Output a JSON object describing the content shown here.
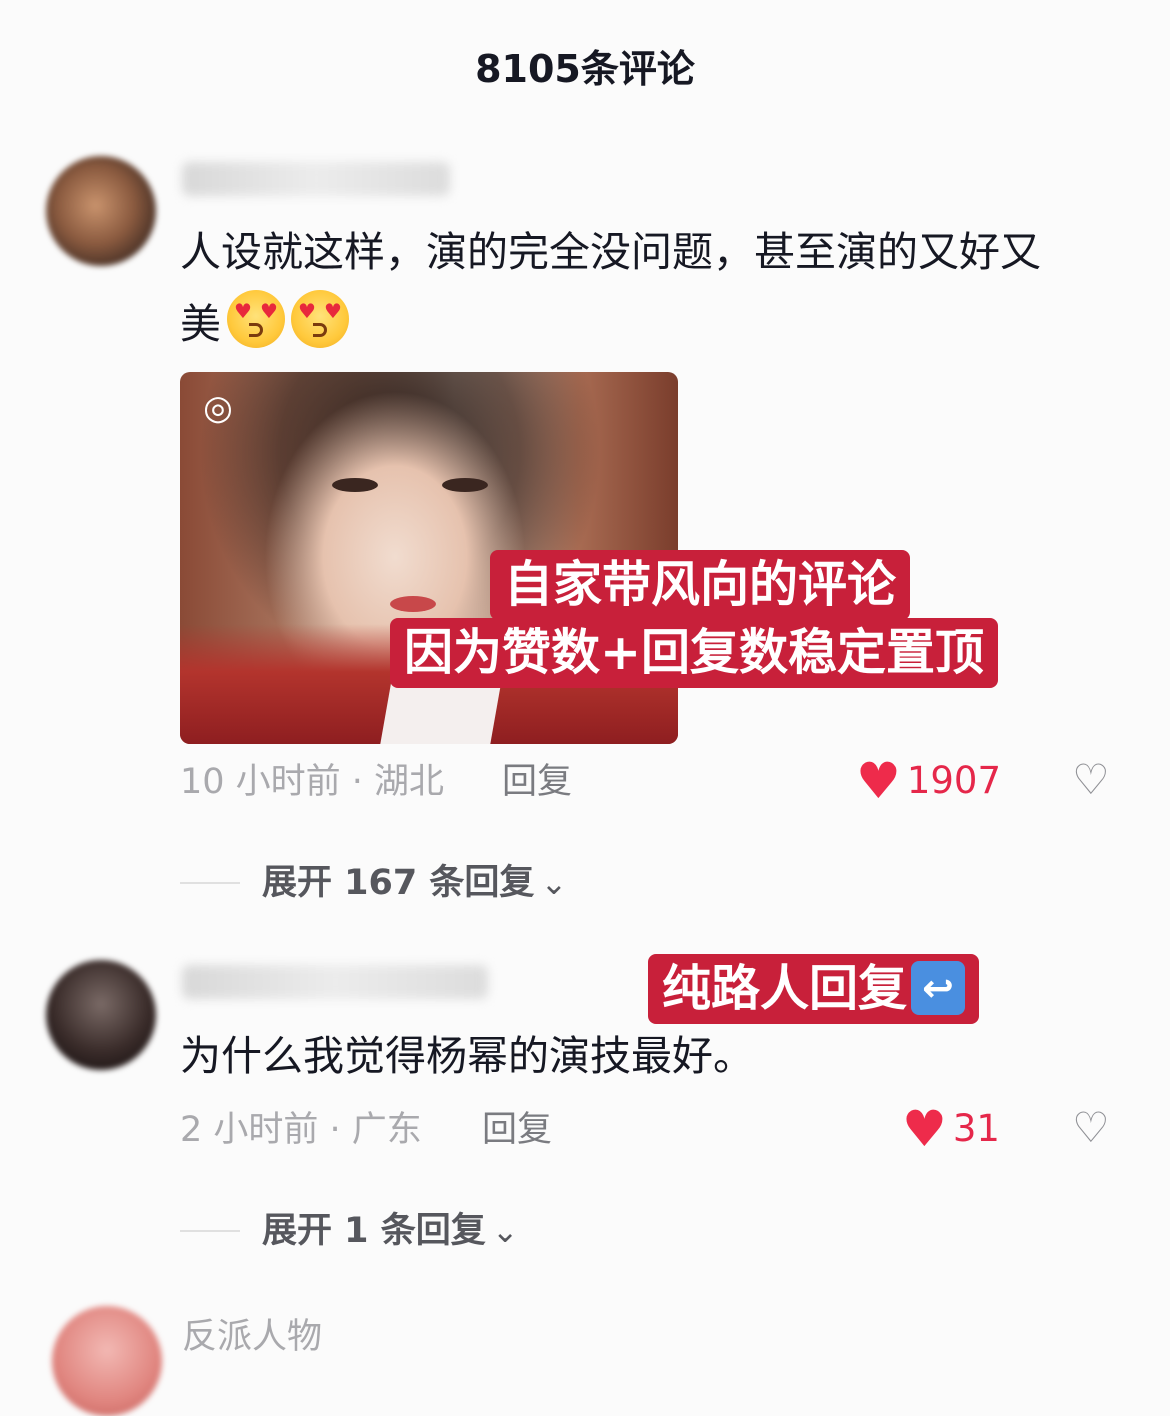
{
  "header": {
    "title": "8105条评论"
  },
  "comments": [
    {
      "text_line1": "人设就这样，演的完全没问题，甚至演的又好又",
      "text_line2": "美",
      "emoji": "smiling-face-with-heart-eyes",
      "image_badge_icon": "live-photo-icon",
      "meta": "10 小时前 · 湖北",
      "reply_label": "回复",
      "likes": "1907",
      "expand_label": "展开 167 条回复"
    },
    {
      "text": "为什么我觉得杨幂的演技最好。",
      "meta": "2 小时前 · 广东",
      "reply_label": "回复",
      "likes": "31",
      "expand_label": "展开 1 条回复"
    }
  ],
  "next_comment": {
    "username": "反派人物"
  },
  "annotations": {
    "label_1_line1": "自家带风向的评论",
    "label_1_line2": "因为赞数+回复数稳定置顶",
    "label_2": "纯路人回复"
  },
  "colors": {
    "like_red": "#ee2b4b",
    "annotation_red": "#c8203a"
  }
}
